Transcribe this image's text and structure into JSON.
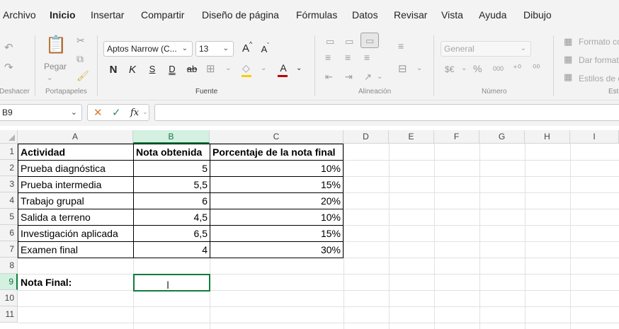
{
  "menu": {
    "items": [
      "Archivo",
      "Inicio",
      "Insertar",
      "Compartir",
      "Diseño de página",
      "Fórmulas",
      "Datos",
      "Revisar",
      "Vista",
      "Ayuda",
      "Dibujo"
    ],
    "active": "Inicio"
  },
  "ribbon": {
    "groups": {
      "undo": "Deshacer",
      "clipboard": "Portapapeles",
      "font": "Fuente",
      "alignment": "Alineación",
      "number": "Número",
      "styles": "Est"
    },
    "paste_label": "Pegar",
    "font_name": "Aptos Narrow (C...",
    "font_size": "13",
    "number_format": "General",
    "bold_label": "N",
    "italic_label": "K",
    "underline_label": "S",
    "double_underline_label": "D",
    "strike_label": "ab",
    "increase_font": "A",
    "decrease_font": "A",
    "font_color_label": "A",
    "number_thousands": "000",
    "styles_items": [
      "Formato co",
      "Dar format",
      "Estilos de c"
    ]
  },
  "formula_bar": {
    "name_box": "B9",
    "fx_label": "fx",
    "formula": ""
  },
  "sheet": {
    "columns": [
      "A",
      "B",
      "C",
      "D",
      "E",
      "F",
      "G",
      "H",
      "I"
    ],
    "selected_column": "B",
    "rows": [
      "1",
      "2",
      "3",
      "4",
      "5",
      "6",
      "7",
      "8",
      "9",
      "10",
      "11"
    ],
    "selected_row": "9",
    "header": [
      "Actividad",
      "Nota obtenida",
      "Porcentaje de la nota final"
    ],
    "data": [
      [
        "Prueba diagnóstica",
        "5",
        "10%"
      ],
      [
        "Prueba intermedia",
        "5,5",
        "15%"
      ],
      [
        "Trabajo grupal",
        "6",
        "20%"
      ],
      [
        "Salida a terreno",
        "4,5",
        "10%"
      ],
      [
        "Investigación aplicada",
        "6,5",
        "15%"
      ],
      [
        "Examen final",
        "4",
        "30%"
      ]
    ],
    "final_label": "Nota Final:",
    "accent_color": "#107c41"
  }
}
